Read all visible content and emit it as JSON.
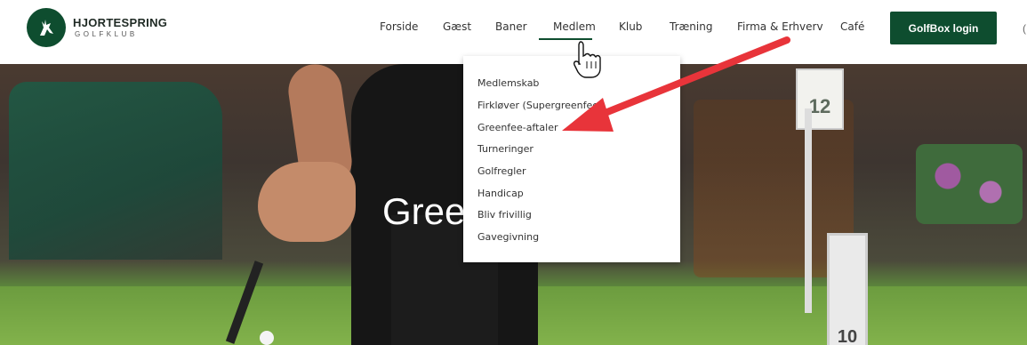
{
  "brand": {
    "name": "HJORTESPRING",
    "sub": "GOLFKLUB"
  },
  "nav": {
    "items": [
      "Forside",
      "Gæst",
      "Baner",
      "Medlem",
      "Klub",
      "Træning",
      "Firma & Erhverv",
      "Café"
    ],
    "active": "Medlem",
    "login_label": "GolfBox login"
  },
  "hero": {
    "title_visible": "Gree",
    "sign_top_number": "12",
    "sign_bottom_number": "10"
  },
  "dropdown": {
    "items": [
      "Medlemskab",
      "Firkløver (Supergreenfee)",
      "Greenfee-aftaler",
      "Turneringer",
      "Golfregler",
      "Handicap",
      "Bliv frivillig",
      "Gavegivning"
    ]
  },
  "colors": {
    "brand_green": "#0e4d2f",
    "arrow_red": "#e8343a"
  }
}
